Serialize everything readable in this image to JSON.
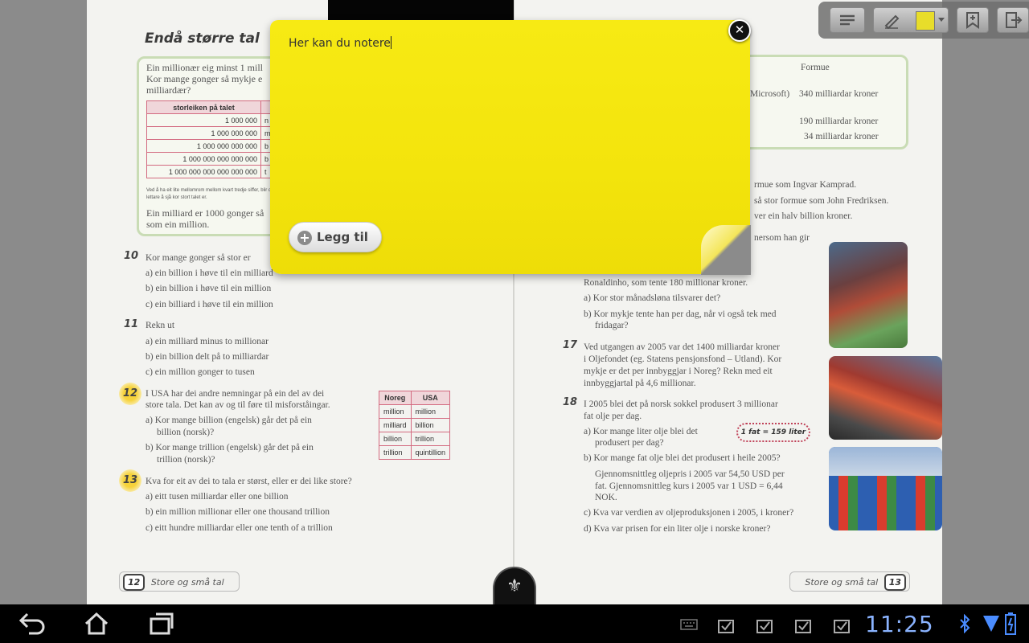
{
  "left_page": {
    "chapter_title": "Endå større tal",
    "box_lines": [
      "Ein millionær eig minst 1 mill",
      "Kor mange gonger så mykje e",
      "milliardær?"
    ],
    "size_table_header": "storleiken på talet",
    "size_table_rows": [
      "1 000 000",
      "1 000 000 000",
      "1 000 000 000 000",
      "1 000 000 000 000 000",
      "1 000 000 000 000 000 000"
    ],
    "size_table_suffix": [
      "n",
      "m",
      "b",
      "b",
      "t"
    ],
    "tiny_note": "Ved å ha eit lite mellomrom mellom kvart tredje siffer, blir det mykje lettare å sjå kor stort talet er.",
    "box_footer": [
      "Ein milliard er 1000 gonger så",
      "som ein million."
    ],
    "task10": {
      "num": "10",
      "lines": [
        "Kor mange gonger så stor er",
        "a) ein billion i høve til ein milliard",
        "b) ein billion i høve til ein million",
        "c) ein billiard i høve til ein million"
      ]
    },
    "task11": {
      "num": "11",
      "lines": [
        "Rekn ut",
        "a) ein milliard minus to millionar",
        "b) ein billion delt på to milliardar",
        "c) ein million gonger to tusen"
      ]
    },
    "task12": {
      "num": "12",
      "lines": [
        "I USA har dei andre nemningar på ein del av dei",
        "store tala. Det kan av og til føre til misforståingar.",
        "a) Kor mange billion (engelsk) går det på ein",
        "billion (norsk)?",
        "b) Kor mange trillion (engelsk) går det på ein",
        "trillion (norsk)?"
      ]
    },
    "usa_table": {
      "headers": [
        "Noreg",
        "USA"
      ],
      "rows": [
        [
          "million",
          "million"
        ],
        [
          "milliard",
          "billion"
        ],
        [
          "billion",
          "trillion"
        ],
        [
          "trillion",
          "quintillion"
        ]
      ]
    },
    "task13": {
      "num": "13",
      "lines": [
        "Kva for eit av dei to tala er størst, eller er dei like store?",
        "a) eitt tusen milliardar eller one billion",
        "b) ein million millionar eller one thousand trillion",
        "c) eitt hundre milliardar eller one tenth of a trillion"
      ]
    },
    "footer_num": "12",
    "footer_label": "Store og små tal"
  },
  "right_page": {
    "wealth_header": "Formue",
    "wealth_rows": [
      {
        "name": "Microsoft)",
        "value": "340 milliardar kroner"
      },
      {
        "name": "",
        "value": "190 milliardar kroner"
      },
      {
        "name": "",
        "value": "34 milliardar kroner"
      }
    ],
    "text_lines": [
      "rmue som Ingvar Kamprad.",
      "så stor formue som John Fredriksen.",
      "ver ein halv billion kroner.",
      "nersom han gir"
    ],
    "task16_lines": [
      "Ronaldinho, som tente 180 millionar kroner.",
      "a) Kor stor månadsløna tilsvarer det?",
      "b) Kor mykje tente han per dag, når vi også tek med",
      "fridagar?"
    ],
    "task17": {
      "num": "17",
      "lines": [
        "Ved utgangen av 2005 var det 1400 milliardar kroner",
        "i Oljefondet (eg. Statens pensjonsfond – Utland). Kor",
        "mykje er det per innbyggjar i Noreg? Rekn med eit",
        "innbyggjartal på 4,6 millionar."
      ]
    },
    "task18": {
      "num": "18",
      "lines": [
        "I 2005 blei det på norsk sokkel produsert 3 millionar",
        "fat olje per dag.",
        "a) Kor mange liter olje blei det",
        "produsert per dag?",
        "b) Kor mange fat olje blei det produsert i heile 2005?",
        "Gjennomsnittleg oljepris i 2005 var 54,50 USD per",
        "fat. Gjennomsnittleg kurs i 2005 var 1 USD = 6,44",
        "NOK.",
        "c) Kva var verdien av oljeproduksjonen i 2005, i kroner?",
        "d) Kva var prisen for ein liter olje i norske kroner?"
      ]
    },
    "fat_badge": "1 fat = 159 liter",
    "footer_label": "Store og små tal",
    "footer_num": "13"
  },
  "note": {
    "text": "Her kan du notere",
    "add_label": "Legg til",
    "color": "#f3e40c"
  },
  "toolbar": {
    "icons": [
      "note-list-icon",
      "pen-icon",
      "color-swatch-icon",
      "bookmark-icon",
      "exit-icon"
    ],
    "swatch_color": "#e8dd2a"
  },
  "system_bar": {
    "clock": "11:25",
    "nav": [
      "back-icon",
      "home-icon",
      "recent-apps-icon"
    ],
    "status": [
      "keyboard-icon",
      "download-done-icon",
      "download-done-icon",
      "download-done-icon",
      "download-done-icon",
      "bluetooth-icon",
      "wifi-icon",
      "battery-icon"
    ]
  }
}
